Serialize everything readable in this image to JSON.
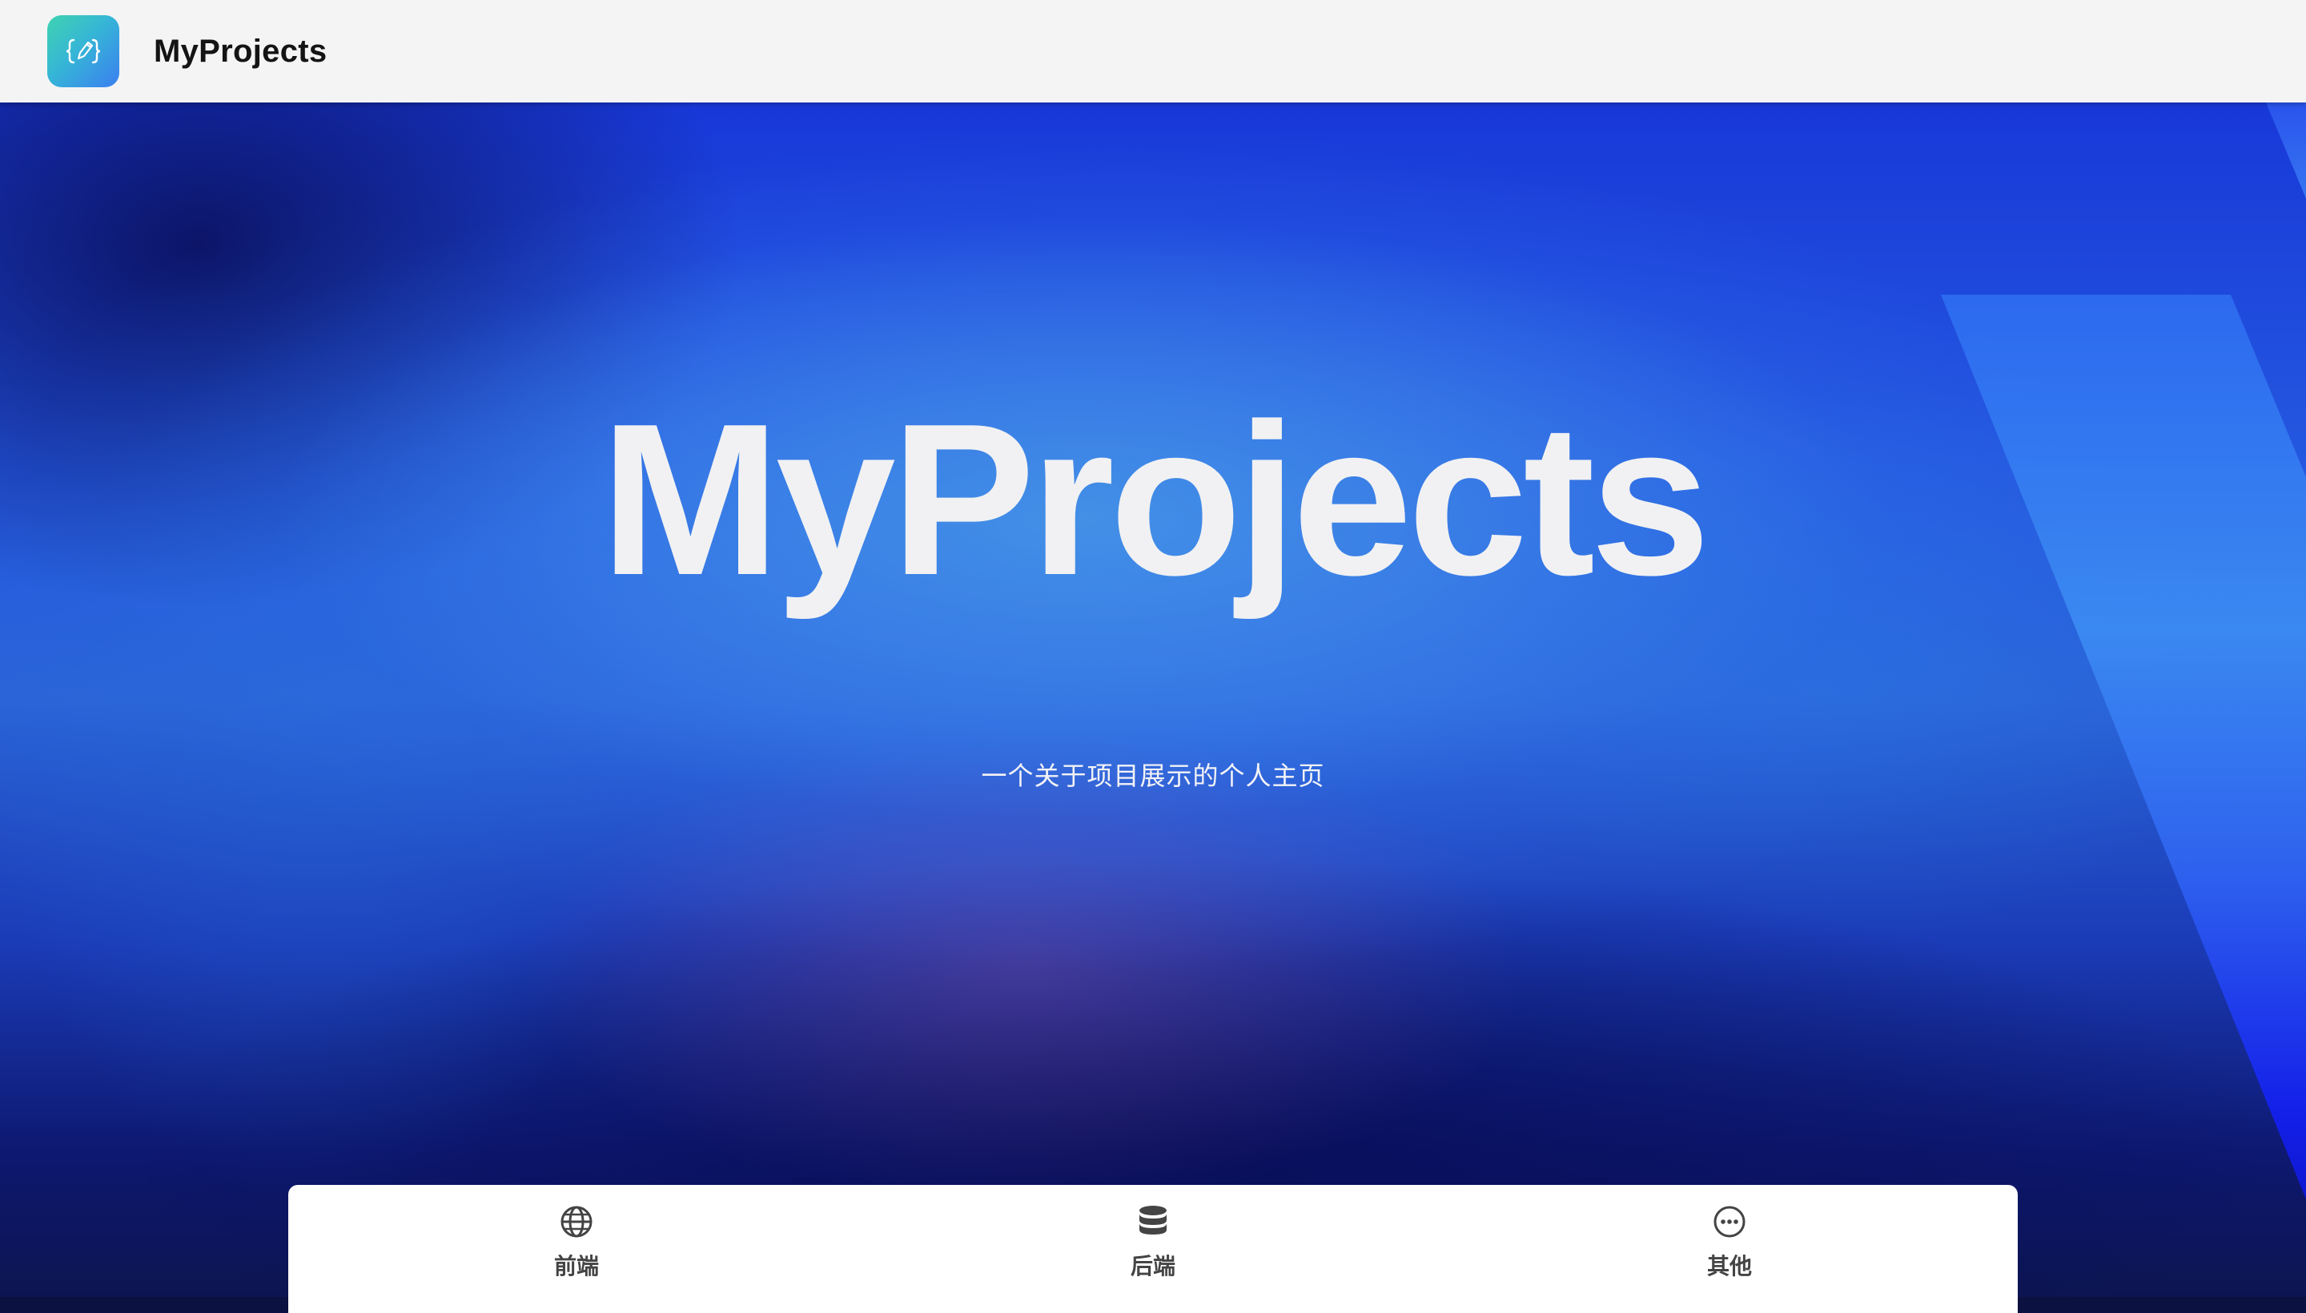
{
  "header": {
    "title": "MyProjects",
    "logo_icon": "code-pencil-icon"
  },
  "hero": {
    "title": "MyProjects",
    "subtitle": "一个关于项目展示的个人主页"
  },
  "nav": {
    "items": [
      {
        "label": "前端",
        "icon": "globe-icon"
      },
      {
        "label": "后端",
        "icon": "database-icon"
      },
      {
        "label": "其他",
        "icon": "more-circle-icon"
      }
    ]
  },
  "colors": {
    "header_bg": "#f4f4f4",
    "logo_gradient_start": "#3fd3b0",
    "logo_gradient_end": "#3a7ef0",
    "hero_blue": "#2458e0",
    "text_light": "#f1f1f3",
    "nav_text": "#444444"
  }
}
